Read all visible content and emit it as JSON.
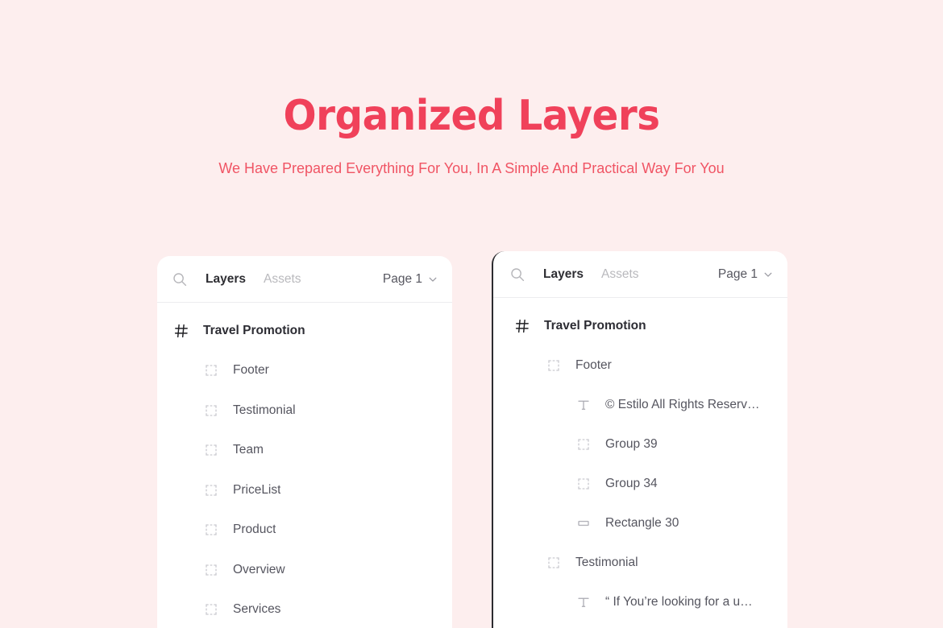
{
  "hero": {
    "title": "Organized Layers",
    "subtitle": "We Have Prepared Everything For You, In A Simple And Practical Way For You",
    "title_color": "#f0415a",
    "subtitle_color": "#f05464",
    "background_color": "#fdeeee"
  },
  "panels": [
    {
      "id": "left-panel",
      "header": {
        "search_icon": "search-icon",
        "tabs": [
          {
            "label": "Layers",
            "active": true
          },
          {
            "label": "Assets",
            "active": false
          }
        ],
        "page_select": {
          "label": "Page 1",
          "icon": "chevron-down-icon"
        }
      },
      "layers": [
        {
          "label": "Travel Promotion",
          "icon": "hash-frame-icon",
          "indent": 0,
          "root": true
        },
        {
          "label": "Footer",
          "icon": "frame-icon",
          "indent": 1,
          "root": false
        },
        {
          "label": "Testimonial",
          "icon": "frame-icon",
          "indent": 1,
          "root": false
        },
        {
          "label": "Team",
          "icon": "frame-icon",
          "indent": 1,
          "root": false
        },
        {
          "label": "PriceList",
          "icon": "frame-icon",
          "indent": 1,
          "root": false
        },
        {
          "label": "Product",
          "icon": "frame-icon",
          "indent": 1,
          "root": false
        },
        {
          "label": "Overview",
          "icon": "frame-icon",
          "indent": 1,
          "root": false
        },
        {
          "label": "Services",
          "icon": "frame-icon",
          "indent": 1,
          "root": false
        }
      ]
    },
    {
      "id": "right-panel",
      "header": {
        "search_icon": "search-icon",
        "tabs": [
          {
            "label": "Layers",
            "active": true
          },
          {
            "label": "Assets",
            "active": false
          }
        ],
        "page_select": {
          "label": "Page 1",
          "icon": "chevron-down-icon"
        }
      },
      "layers": [
        {
          "label": "Travel Promotion",
          "icon": "hash-frame-icon",
          "indent": 0,
          "root": true
        },
        {
          "label": "Footer",
          "icon": "frame-icon",
          "indent": 1,
          "root": false
        },
        {
          "label": "© Estilo All Rights Reserv…",
          "icon": "text-icon",
          "indent": 2,
          "root": false
        },
        {
          "label": "Group 39",
          "icon": "frame-icon",
          "indent": 2,
          "root": false
        },
        {
          "label": "Group 34",
          "icon": "frame-icon",
          "indent": 2,
          "root": false
        },
        {
          "label": "Rectangle 30",
          "icon": "rectangle-icon",
          "indent": 2,
          "root": false
        },
        {
          "label": "Testimonial",
          "icon": "frame-icon",
          "indent": 1,
          "root": false
        },
        {
          "label": "“ If You’re looking for a u…",
          "icon": "text-icon",
          "indent": 2,
          "root": false
        }
      ]
    }
  ]
}
